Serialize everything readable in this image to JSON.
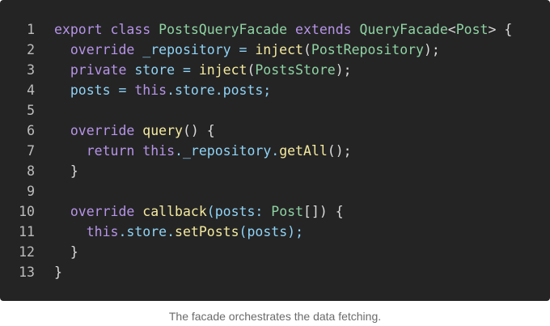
{
  "colors": {
    "background": "#242424",
    "keyword": "#b694e8",
    "class_name": "#8fd3a4",
    "identifier": "#8fd3f6",
    "method": "#f5eaa0",
    "operator": "#dcdcdc",
    "line_number": "#bdbdbd",
    "caption": "#6b6b6b"
  },
  "code": {
    "lines": [
      {
        "num": "1",
        "tokens": [
          {
            "t": "export class ",
            "c": "keyword"
          },
          {
            "t": "PostsQueryFacade",
            "c": "class_name"
          },
          {
            "t": " extends ",
            "c": "keyword"
          },
          {
            "t": "QueryFacade",
            "c": "class_name"
          },
          {
            "t": "<",
            "c": "operator"
          },
          {
            "t": "Post",
            "c": "class_name"
          },
          {
            "t": "> {",
            "c": "operator"
          }
        ]
      },
      {
        "num": "2",
        "tokens": [
          {
            "t": "  ",
            "c": "operator"
          },
          {
            "t": "override",
            "c": "keyword"
          },
          {
            "t": " _repository = ",
            "c": "identifier"
          },
          {
            "t": "inject",
            "c": "method"
          },
          {
            "t": "(",
            "c": "operator"
          },
          {
            "t": "PostRepository",
            "c": "class_name"
          },
          {
            "t": ");",
            "c": "operator"
          }
        ]
      },
      {
        "num": "3",
        "tokens": [
          {
            "t": "  ",
            "c": "operator"
          },
          {
            "t": "private",
            "c": "keyword"
          },
          {
            "t": " store = ",
            "c": "identifier"
          },
          {
            "t": "inject",
            "c": "method"
          },
          {
            "t": "(",
            "c": "operator"
          },
          {
            "t": "PostsStore",
            "c": "class_name"
          },
          {
            "t": ");",
            "c": "operator"
          }
        ]
      },
      {
        "num": "4",
        "tokens": [
          {
            "t": "  posts = ",
            "c": "identifier"
          },
          {
            "t": "this",
            "c": "keyword"
          },
          {
            "t": ".store.posts;",
            "c": "identifier"
          }
        ]
      },
      {
        "num": "5",
        "tokens": []
      },
      {
        "num": "6",
        "tokens": [
          {
            "t": "  ",
            "c": "operator"
          },
          {
            "t": "override",
            "c": "keyword"
          },
          {
            "t": " ",
            "c": "operator"
          },
          {
            "t": "query",
            "c": "method"
          },
          {
            "t": "() {",
            "c": "operator"
          }
        ]
      },
      {
        "num": "7",
        "tokens": [
          {
            "t": "    ",
            "c": "operator"
          },
          {
            "t": "return",
            "c": "keyword"
          },
          {
            "t": " ",
            "c": "operator"
          },
          {
            "t": "this",
            "c": "keyword"
          },
          {
            "t": "._repository.",
            "c": "identifier"
          },
          {
            "t": "getAll",
            "c": "method"
          },
          {
            "t": "();",
            "c": "operator"
          }
        ]
      },
      {
        "num": "8",
        "tokens": [
          {
            "t": "  }",
            "c": "operator"
          }
        ]
      },
      {
        "num": "9",
        "tokens": []
      },
      {
        "num": "10",
        "tokens": [
          {
            "t": "  ",
            "c": "operator"
          },
          {
            "t": "override",
            "c": "keyword"
          },
          {
            "t": " ",
            "c": "operator"
          },
          {
            "t": "callback",
            "c": "method"
          },
          {
            "t": "(posts: ",
            "c": "identifier"
          },
          {
            "t": "Post",
            "c": "class_name"
          },
          {
            "t": "[]) {",
            "c": "operator"
          }
        ]
      },
      {
        "num": "11",
        "tokens": [
          {
            "t": "    ",
            "c": "operator"
          },
          {
            "t": "this",
            "c": "keyword"
          },
          {
            "t": ".store.",
            "c": "identifier"
          },
          {
            "t": "setPosts",
            "c": "method"
          },
          {
            "t": "(posts);",
            "c": "identifier"
          }
        ]
      },
      {
        "num": "12",
        "tokens": [
          {
            "t": "  }",
            "c": "operator"
          }
        ]
      },
      {
        "num": "13",
        "tokens": [
          {
            "t": "}",
            "c": "operator"
          }
        ]
      }
    ]
  },
  "caption": "The facade orchestrates the data fetching."
}
